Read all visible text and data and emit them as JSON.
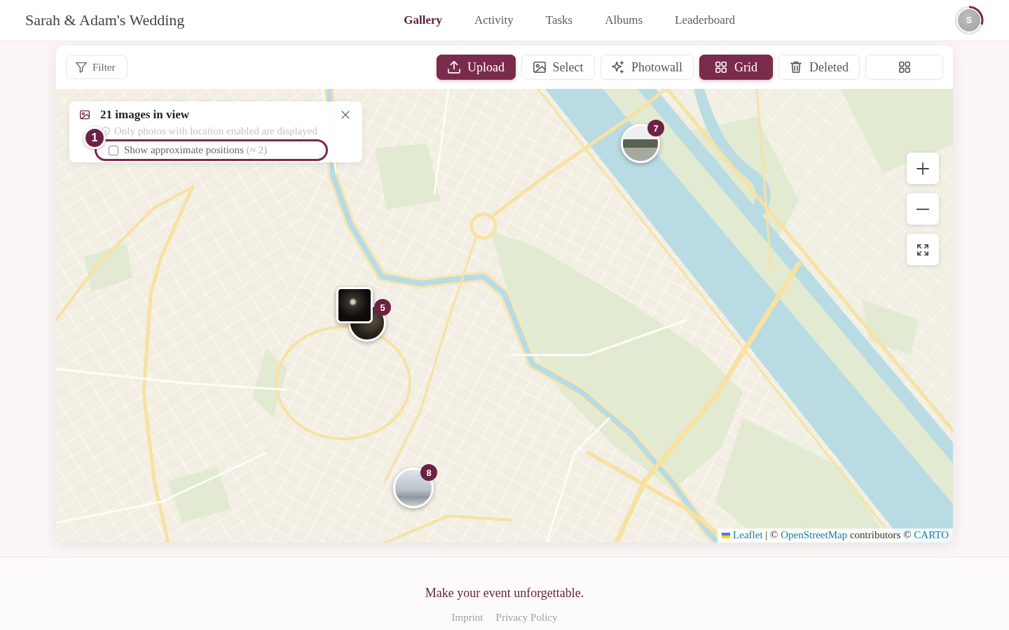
{
  "header": {
    "title": "Sarah & Adam's Wedding",
    "nav": [
      {
        "label": "Gallery",
        "selected": true
      },
      {
        "label": "Activity",
        "selected": false
      },
      {
        "label": "Tasks",
        "selected": false
      },
      {
        "label": "Albums",
        "selected": false
      },
      {
        "label": "Leaderboard",
        "selected": false
      }
    ],
    "avatar": {
      "initial": "S",
      "level": 0.3
    }
  },
  "toolbar": {
    "filter": {
      "label": "Filter"
    },
    "buttons": [
      {
        "kind": "primary",
        "label": "Upload"
      },
      {
        "kind": "plain",
        "label": "Select"
      },
      {
        "kind": "plain",
        "label": "Photowall"
      },
      {
        "kind": "view",
        "label": "Grid",
        "selected": true
      },
      {
        "kind": "plain",
        "label": "Deleted"
      },
      {
        "kind": "icon-only"
      }
    ]
  },
  "map": {
    "info_panel": {
      "title": "21 images in view",
      "note": "Only photos with location enabled are displayed",
      "option": {
        "label": "Show approximate positions",
        "count": "(≈ 2)",
        "checked": false,
        "highlighted": true
      },
      "tour_step": "1"
    },
    "markers": [
      {
        "kind": "cluster",
        "count": "7"
      },
      {
        "kind": "preview",
        "count": "5"
      },
      {
        "kind": "cluster",
        "count": "8"
      }
    ],
    "attribution": [
      {
        "kind": "link",
        "text": "Leaflet"
      },
      {
        "kind": "text",
        "text": "| ©"
      },
      {
        "kind": "link",
        "text": "OpenStreetMap"
      },
      {
        "kind": "text",
        "text": "contributors ©"
      },
      {
        "kind": "link",
        "text": "CARTO"
      }
    ]
  },
  "footer": {
    "tagline": "Make your event unforgettable.",
    "links": [
      "Imprint",
      "Privacy Policy"
    ]
  }
}
